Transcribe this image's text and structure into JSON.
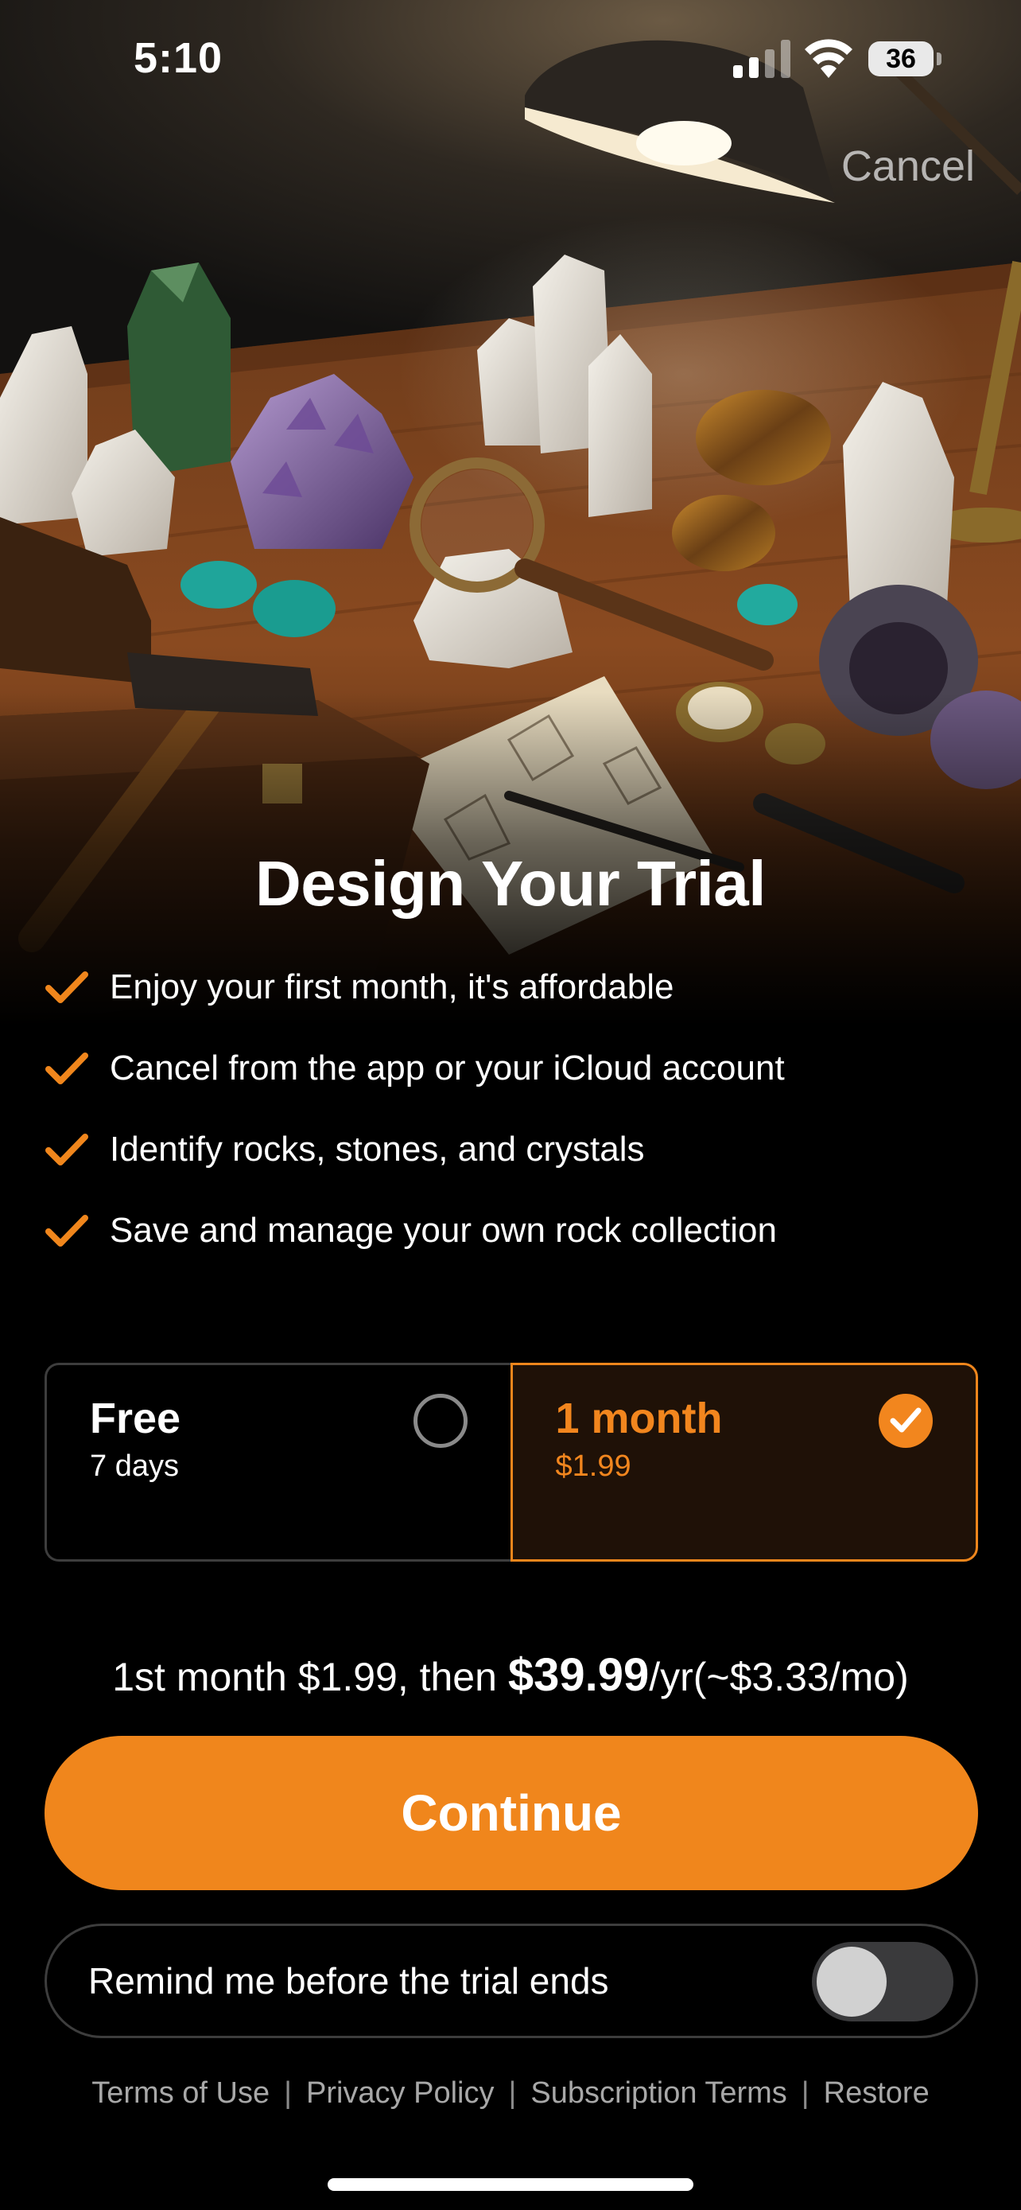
{
  "status_bar": {
    "time": "5:10",
    "battery_level": "36"
  },
  "header": {
    "cancel_label": "Cancel"
  },
  "title": "Design Your Trial",
  "features": [
    "Enjoy your first month, it's affordable",
    "Cancel from the app or your iCloud account",
    "Identify rocks, stones, and crystals",
    "Save and manage your own rock collection"
  ],
  "plans": [
    {
      "name": "Free",
      "detail": "7 days",
      "selected": false
    },
    {
      "name": "1 month",
      "detail": "$1.99",
      "selected": true
    }
  ],
  "pricing": {
    "prefix": "1st month $1.99, then ",
    "price": "$39.99",
    "suffix": "/yr(~$3.33/mo)"
  },
  "continue_label": "Continue",
  "reminder": {
    "label": "Remind me before the trial ends",
    "enabled": false
  },
  "footer_links": [
    "Terms of Use",
    "Privacy Policy",
    "Subscription Terms",
    "Restore"
  ],
  "colors": {
    "accent": "#f0861c",
    "selected_plan_bg": "#1f1107",
    "background": "#000000"
  },
  "icons": [
    "signal-icon",
    "wifi-icon",
    "battery-icon",
    "check-icon",
    "radio-icon",
    "checkmark-circle-icon"
  ]
}
